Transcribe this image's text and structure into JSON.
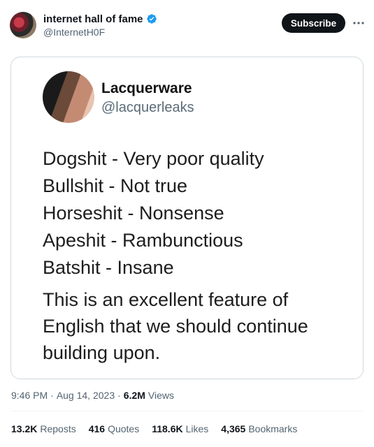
{
  "author": {
    "display_name": "internet hall of fame",
    "handle": "@InternetH0F"
  },
  "subscribe_label": "Subscribe",
  "quoted": {
    "name": "Lacquerware",
    "handle": "@lacquerleaks",
    "lines": [
      "Dogshit - Very poor quality",
      "Bullshit - Not true",
      "Horseshit - Nonsense",
      "Apeshit - Rambunctious",
      "Batshit - Insane"
    ],
    "paragraph": "This is an excellent feature of English that we should continue building upon."
  },
  "meta": {
    "time": "9:46 PM",
    "sep1": "·",
    "date": "Aug 14, 2023",
    "sep2": "·",
    "views_count": "6.2M",
    "views_label": "Views"
  },
  "stats": {
    "reposts_count": "13.2K",
    "reposts_label": "Reposts",
    "quotes_count": "416",
    "quotes_label": "Quotes",
    "likes_count": "118.6K",
    "likes_label": "Likes",
    "bookmarks_count": "4,365",
    "bookmarks_label": "Bookmarks"
  },
  "colors": {
    "verified": "#1d9bf0",
    "subscribe_bg": "#0f1419",
    "secondary_text": "#536471"
  },
  "icons": {
    "verified": "verified-badge-icon",
    "more": "more-horizontal-icon"
  }
}
